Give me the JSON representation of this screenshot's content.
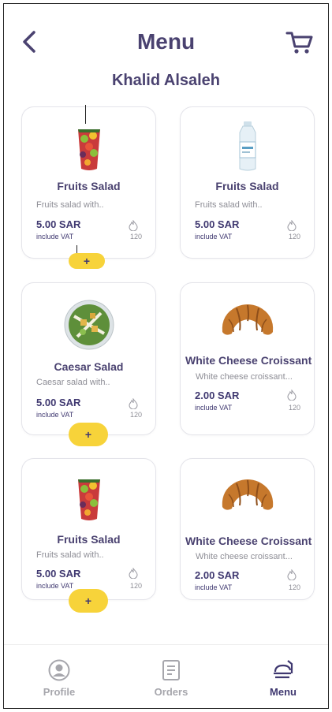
{
  "header": {
    "title": "Menu"
  },
  "customer_name": "Khalid Alsaleh",
  "products": [
    {
      "name": "Fruits Salad",
      "description": "Fruits salad with..",
      "price": "5.00 SAR",
      "vat": "include VAT",
      "calories": "120",
      "image": "fruit-cup"
    },
    {
      "name": "Fruits Salad",
      "description": "Fruits salad with..",
      "price": "5.00 SAR",
      "vat": "include VAT",
      "calories": "120",
      "image": "water-bottle"
    },
    {
      "name": "Caesar Salad",
      "description": "Caesar salad with..",
      "price": "5.00 SAR",
      "vat": "include VAT",
      "calories": "120",
      "image": "caesar-salad-bowl"
    },
    {
      "name": "White Cheese Croissant",
      "description": "White cheese croissant...",
      "price": "2.00 SAR",
      "vat": "include VAT",
      "calories": "120",
      "image": "croissant"
    },
    {
      "name": "Fruits Salad",
      "description": "Fruits salad with..",
      "price": "5.00 SAR",
      "vat": "include VAT",
      "calories": "120",
      "image": "fruit-cup"
    },
    {
      "name": "White Cheese Croissant",
      "description": "White cheese croissant...",
      "price": "2.00 SAR",
      "vat": "include VAT",
      "calories": "120",
      "image": "croissant"
    }
  ],
  "add_button_label": "+",
  "bottom_nav": [
    {
      "label": "Profile",
      "icon": "profile-icon",
      "active": false
    },
    {
      "label": "Orders",
      "icon": "orders-icon",
      "active": false
    },
    {
      "label": "Menu",
      "icon": "menu-icon",
      "active": true
    }
  ],
  "colors": {
    "primary": "#4a4270",
    "accent": "#f7d33a",
    "muted": "#a6a6ac"
  }
}
